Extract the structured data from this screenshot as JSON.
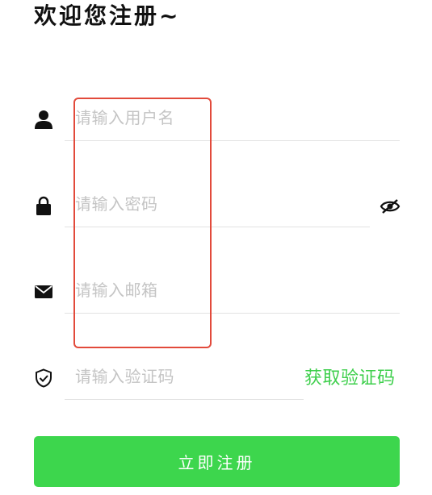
{
  "header": {
    "title": "欢迎您注册~"
  },
  "form": {
    "username": {
      "placeholder": "请输入用户名",
      "icon": "user-icon"
    },
    "password": {
      "placeholder": "请输入密码",
      "icon": "lock-icon",
      "toggle_icon": "eye-off-icon"
    },
    "email": {
      "placeholder": "请输入邮箱",
      "icon": "mail-icon"
    },
    "code": {
      "placeholder": "请输入验证码",
      "icon": "shield-check-icon",
      "get_code_label": "获取验证码"
    },
    "submit_label": "立即注册"
  },
  "colors": {
    "accent": "#3dd64d",
    "link": "#3ecf4c",
    "highlight_border": "#e24a3b"
  }
}
